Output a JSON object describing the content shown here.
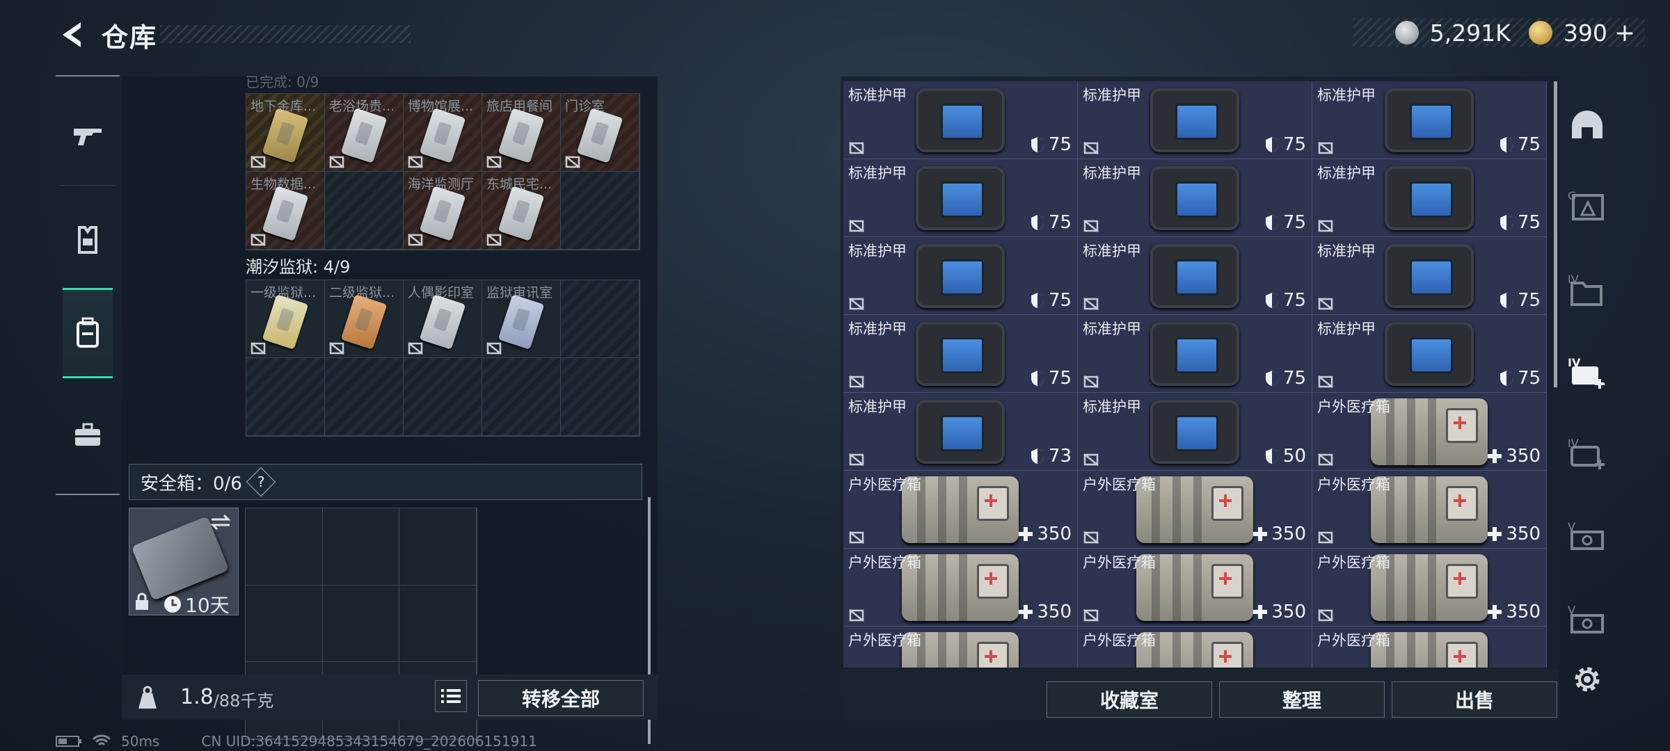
{
  "header": {
    "title": "仓库"
  },
  "currency": {
    "silver": "5,291K",
    "gold": "390",
    "plus": "+"
  },
  "left_nav": [
    "weapon-icon",
    "armor-vest-icon",
    "backpack-icon",
    "briefcase-icon"
  ],
  "sections": {
    "upper_title": "已完成: 0/9",
    "upper_cells": [
      {
        "name": "地下金库...",
        "card": "gold"
      },
      {
        "name": "老浴场贵...",
        "card": "white"
      },
      {
        "name": "博物馆展...",
        "card": "white"
      },
      {
        "name": "旅店用餐间",
        "card": "white"
      },
      {
        "name": "门诊室",
        "card": "white"
      },
      {
        "name": "生物数据...",
        "card": "white"
      },
      {
        "name": "",
        "card": ""
      },
      {
        "name": "海洋监测厅",
        "card": "white"
      },
      {
        "name": "东城民宅...",
        "card": "white"
      },
      {
        "name": "",
        "card": ""
      }
    ],
    "prison_title": "潮汐监狱: 4/9",
    "prison_cells": [
      {
        "name": "一级监狱...",
        "card": "yellow"
      },
      {
        "name": "二级监狱...",
        "card": "orange"
      },
      {
        "name": "人偶影印室",
        "card": "white"
      },
      {
        "name": "监狱审讯室",
        "card": "blue"
      },
      {
        "name": "",
        "card": ""
      }
    ]
  },
  "safebox": {
    "label": "安全箱：0/6",
    "help": "?",
    "duration": "10天"
  },
  "weight": {
    "current": "1.8",
    "max": "/88千克"
  },
  "buttons": {
    "transfer_all": "转移全部",
    "collection": "收藏室",
    "sort": "整理",
    "sell": "出售"
  },
  "stash": [
    {
      "name": "标准护甲",
      "type": "armor",
      "value": "75"
    },
    {
      "name": "标准护甲",
      "type": "armor",
      "value": "75"
    },
    {
      "name": "标准护甲",
      "type": "armor",
      "value": "75"
    },
    {
      "name": "标准护甲",
      "type": "armor",
      "value": "75"
    },
    {
      "name": "标准护甲",
      "type": "armor",
      "value": "75"
    },
    {
      "name": "标准护甲",
      "type": "armor",
      "value": "75"
    },
    {
      "name": "标准护甲",
      "type": "armor",
      "value": "75"
    },
    {
      "name": "标准护甲",
      "type": "armor",
      "value": "75"
    },
    {
      "name": "标准护甲",
      "type": "armor",
      "value": "75"
    },
    {
      "name": "标准护甲",
      "type": "armor",
      "value": "75"
    },
    {
      "name": "标准护甲",
      "type": "armor",
      "value": "75"
    },
    {
      "name": "标准护甲",
      "type": "armor",
      "value": "75"
    },
    {
      "name": "标准护甲",
      "type": "armor",
      "value": "73"
    },
    {
      "name": "标准护甲",
      "type": "armor",
      "value": "50"
    },
    {
      "name": "户外医疗箱",
      "type": "medkit",
      "value": "350"
    },
    {
      "name": "户外医疗箱",
      "type": "medkit",
      "value": "350"
    },
    {
      "name": "户外医疗箱",
      "type": "medkit",
      "value": "350"
    },
    {
      "name": "户外医疗箱",
      "type": "medkit",
      "value": "350"
    },
    {
      "name": "户外医疗箱",
      "type": "medkit",
      "value": "350"
    },
    {
      "name": "户外医疗箱",
      "type": "medkit",
      "value": "350"
    },
    {
      "name": "户外医疗箱",
      "type": "medkit",
      "value": "350"
    },
    {
      "name": "户外医疗箱",
      "type": "medkit",
      "value": ""
    },
    {
      "name": "户外医疗箱",
      "type": "medkit",
      "value": ""
    },
    {
      "name": "户外医疗箱",
      "type": "medkit",
      "value": ""
    }
  ],
  "right_tabs": [
    "helmet-icon",
    "armor-tier-icon",
    "container-tier-icon",
    "medkit-tier-icon",
    "medkit-tier-icon-2",
    "vehicle-icon",
    "vehicle-icon-2"
  ],
  "status": {
    "ping": "50ms",
    "uid": "CN UID:3641529485343154679_202606151911"
  }
}
